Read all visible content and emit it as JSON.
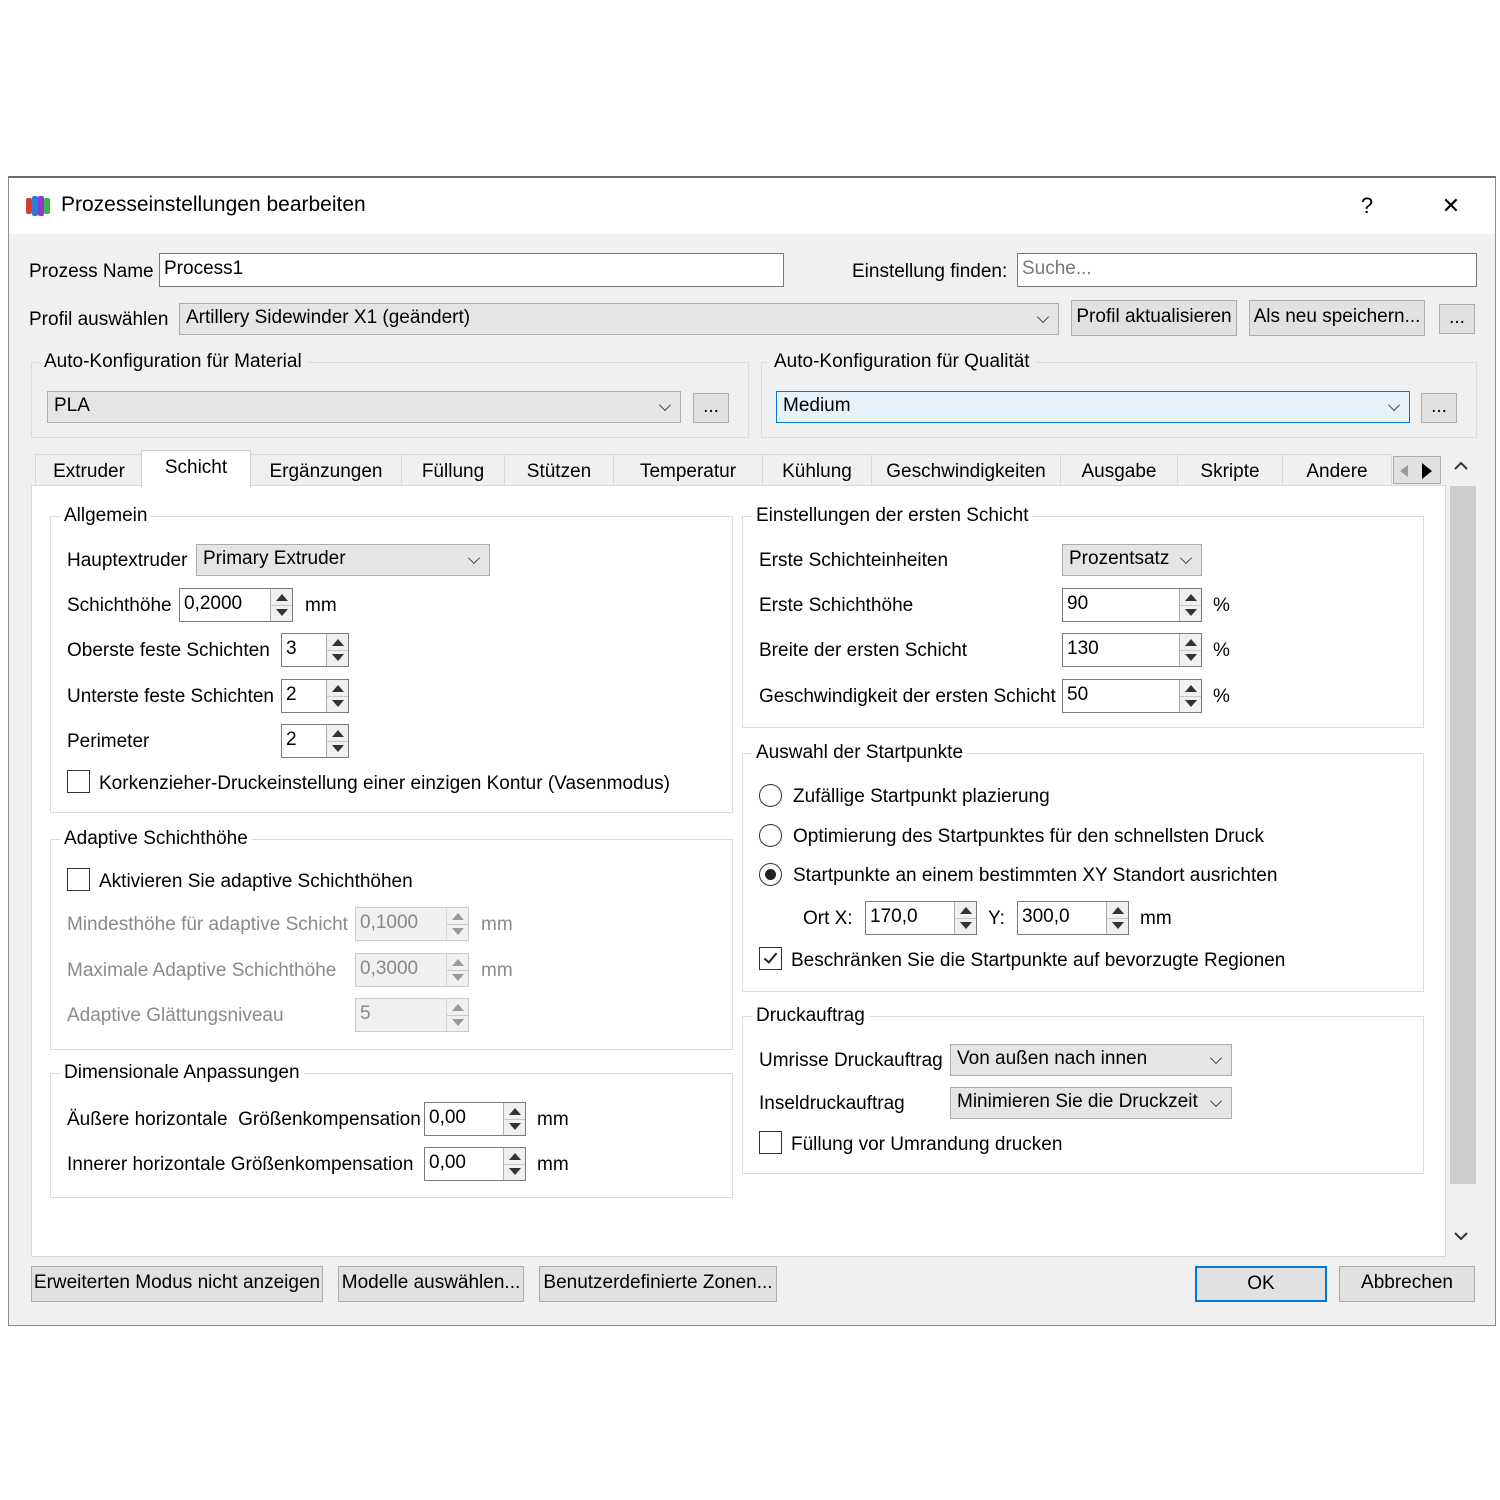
{
  "window": {
    "title": "Prozesseinstellungen bearbeiten",
    "help": "?",
    "close": "✕"
  },
  "header": {
    "process_name_label": "Prozess Name",
    "process_name_value": "Process1",
    "find_label": "Einstellung finden:",
    "find_placeholder": "Suche...",
    "profile_label": "Profil auswählen",
    "profile_value": "Artillery Sidewinder X1 (geändert)",
    "update_profile": "Profil aktualisieren",
    "save_as_new": "Als neu speichern...",
    "more": "..."
  },
  "auto_material": {
    "title": "Auto-Konfiguration für Material",
    "value": "PLA",
    "more": "..."
  },
  "auto_quality": {
    "title": "Auto-Konfiguration für Qualität",
    "value": "Medium",
    "more": "..."
  },
  "tabs": [
    "Extruder",
    "Schicht",
    "Ergänzungen",
    "Füllung",
    "Stützen",
    "Temperatur",
    "Kühlung",
    "Geschwindigkeiten",
    "Ausgabe",
    "Skripte",
    "Andere"
  ],
  "active_tab": "Schicht",
  "general": {
    "title": "Allgemein",
    "main_extruder_label": "Hauptextruder",
    "main_extruder_value": "Primary Extruder",
    "layer_height_label": "Schichthöhe",
    "layer_height_value": "0,2000",
    "layer_height_unit": "mm",
    "top_layers_label": "Oberste feste Schichten",
    "top_layers_value": "3",
    "bottom_layers_label": "Unterste feste Schichten",
    "bottom_layers_value": "2",
    "perimeter_label": "Perimeter",
    "perimeter_value": "2",
    "vase_mode_label": "Korkenzieher-Druckeinstellung einer einzigen Kontur (Vasenmodus)",
    "vase_mode_checked": false
  },
  "adaptive": {
    "title": "Adaptive Schichthöhe",
    "enable_label": "Aktivieren Sie adaptive Schichthöhen",
    "enable_checked": false,
    "min_label": "Mindesthöhe für adaptive Schicht",
    "min_value": "0,1000",
    "min_unit": "mm",
    "max_label": "Maximale Adaptive Schichthöhe",
    "max_value": "0,3000",
    "max_unit": "mm",
    "smooth_label": "Adaptive Glättungsniveau",
    "smooth_value": "5"
  },
  "dimensional": {
    "title": "Dimensionale Anpassungen",
    "outer_label": "Äußere horizontale  Größenkompensation",
    "outer_value": "0,00",
    "outer_unit": "mm",
    "inner_label": "Innerer horizontale Größenkompensation",
    "inner_value": "0,00",
    "inner_unit": "mm"
  },
  "first_layer": {
    "title": "Einstellungen der ersten Schicht",
    "units_label": "Erste Schichteinheiten",
    "units_value": "Prozentsatz",
    "height_label": "Erste Schichthöhe",
    "height_value": "90",
    "height_unit": "%",
    "width_label": "Breite der ersten Schicht",
    "width_value": "130",
    "width_unit": "%",
    "speed_label": "Geschwindigkeit der ersten Schicht",
    "speed_value": "50",
    "speed_unit": "%"
  },
  "start_points": {
    "title": "Auswahl der Startpunkte",
    "random_label": "Zufällige Startpunkt plazierung",
    "optimize_label": "Optimierung des Startpunktes für den schnellsten Druck",
    "align_label": "Startpunkte an einem bestimmten XY Standort ausrichten",
    "selected": "align",
    "x_label": "Ort X:",
    "x_value": "170,0",
    "y_label": "Y:",
    "y_value": "300,0",
    "xy_unit": "mm",
    "restrict_label": "Beschränken Sie die Startpunkte auf bevorzugte Regionen",
    "restrict_checked": true
  },
  "print_order": {
    "title": "Druckauftrag",
    "outline_label": "Umrisse Druckauftrag",
    "outline_value": "Von außen nach innen",
    "island_label": "Inseldruckauftrag",
    "island_value": "Minimieren Sie die Druckzeit",
    "infill_first_label": "Füllung vor Umrandung drucken",
    "infill_first_checked": false
  },
  "footer": {
    "hide_advanced": "Erweiterten Modus nicht anzeigen",
    "select_models": "Modelle auswählen...",
    "custom_zones": "Benutzerdefinierte Zonen...",
    "ok": "OK",
    "cancel": "Abbrechen"
  },
  "colors": {
    "accent": "#0078d7",
    "dialog_bg": "#f0f0f0",
    "page_bg": "#ffffff"
  }
}
